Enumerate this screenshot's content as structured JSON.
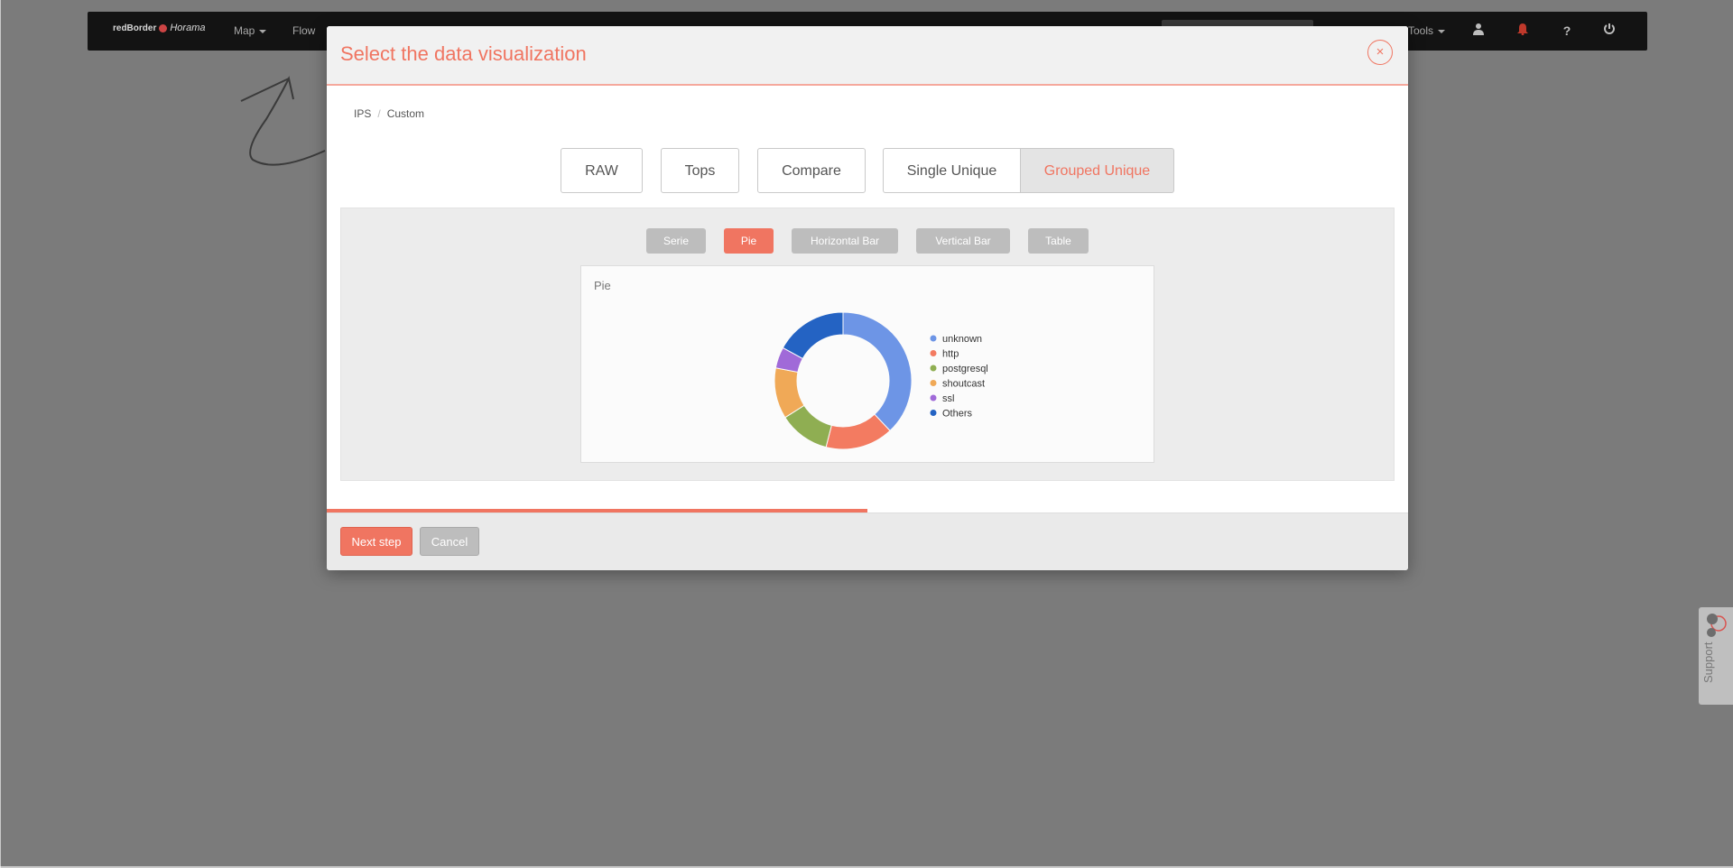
{
  "navbar": {
    "logo_text": "redBorder",
    "logo_sub": "Horama",
    "items": [
      {
        "label": "Map",
        "dropdown": true
      },
      {
        "label": "Flow",
        "dropdown": false
      },
      {
        "label": "Tools",
        "dropdown": true
      }
    ],
    "icons": [
      "user-icon",
      "bell-icon",
      "help-icon",
      "power-icon"
    ]
  },
  "modal": {
    "title": "Select the data visualization",
    "close_icon": "×",
    "breadcrumb": [
      "IPS",
      "Custom"
    ],
    "breadcrumb_sep": "/",
    "types": [
      {
        "label": "RAW",
        "selected": false
      },
      {
        "label": "Tops",
        "selected": false
      },
      {
        "label": "Compare",
        "selected": false
      },
      {
        "label": "Single Unique",
        "selected": false
      },
      {
        "label": "Grouped Unique",
        "selected": true
      }
    ],
    "subtabs": [
      {
        "label": "Serie",
        "active": false
      },
      {
        "label": "Pie",
        "active": true
      },
      {
        "label": "Horizontal Bar",
        "active": false
      },
      {
        "label": "Vertical Bar",
        "active": false
      },
      {
        "label": "Table",
        "active": false
      }
    ],
    "progress": 0.5,
    "footer": {
      "next_label": "Next step",
      "cancel_label": "Cancel"
    }
  },
  "support": {
    "label": "Support"
  },
  "colors": {
    "accent": "#f07561"
  },
  "chart_data": {
    "type": "pie",
    "donut": true,
    "title": "Pie",
    "categories": [
      "unknown",
      "http",
      "postgresql",
      "shoutcast",
      "ssl",
      "Others"
    ],
    "values": [
      38,
      16,
      12,
      12,
      5,
      17
    ],
    "colors": [
      "#6d95e6",
      "#f37b61",
      "#8fae52",
      "#f0a957",
      "#a06ad8",
      "#2463c3"
    ],
    "legend": "right"
  }
}
